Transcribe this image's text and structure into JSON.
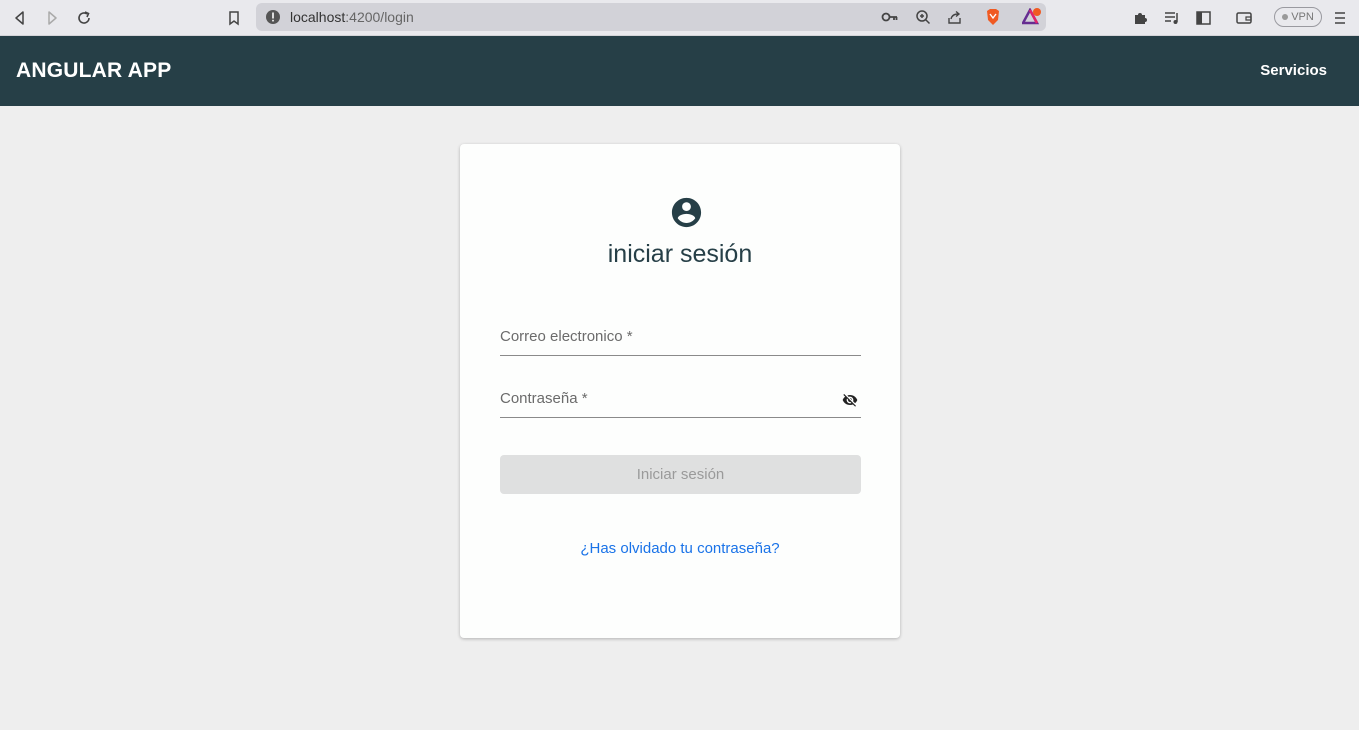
{
  "browser": {
    "url_host": "localhost",
    "url_path": ":4200/login",
    "vpn_label": "VPN",
    "notification_count": "1"
  },
  "header": {
    "title": "ANGULAR APP",
    "nav_link": "Servicios"
  },
  "login": {
    "title": "iniciar sesión",
    "email_label": "Correo electronico *",
    "password_label": "Contraseña *",
    "submit_label": "Iniciar sesión",
    "forgot_link": "¿Has olvidado tu contraseña?"
  },
  "colors": {
    "header_bg": "#263f47",
    "page_bg": "#eeeeee",
    "link": "#1a73e8",
    "disabled_btn": "#dfe0e0"
  },
  "icons": [
    "back-icon",
    "forward-icon",
    "reload-icon",
    "bookmark-icon",
    "site-info-icon",
    "key-icon",
    "zoom-icon",
    "share-icon",
    "brave-shield-icon",
    "brave-rewards-icon",
    "extensions-icon",
    "media-icon",
    "sidebar-icon",
    "wallet-icon",
    "menu-icon",
    "account-circle-icon",
    "visibility-off-icon"
  ]
}
